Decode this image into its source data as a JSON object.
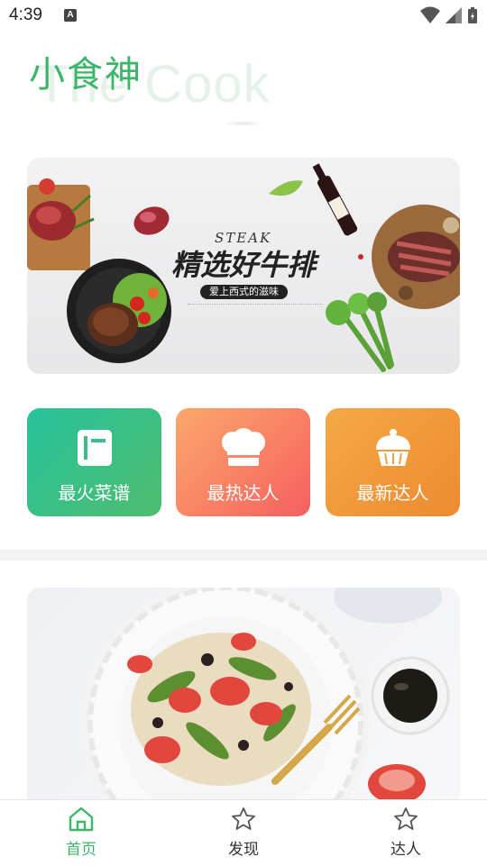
{
  "status_bar": {
    "time": "4:39",
    "notification_letter": "A"
  },
  "header": {
    "title": "小食神",
    "subtitle": "The Cook"
  },
  "banner": {
    "steak_word": "STEAK",
    "title": "精选好牛排",
    "subtitle": "爱上西式的滋味"
  },
  "categories": [
    {
      "label": "最火菜谱",
      "icon": "recipe-book-icon",
      "color": "#2fc08a"
    },
    {
      "label": "最热达人",
      "icon": "chef-hat-icon",
      "color": "#f77d62"
    },
    {
      "label": "最新达人",
      "icon": "cupcake-icon",
      "color": "#f09c3b"
    }
  ],
  "bottom_nav": [
    {
      "label": "首页",
      "icon": "home-icon",
      "active": true
    },
    {
      "label": "发现",
      "icon": "star-icon",
      "active": false
    },
    {
      "label": "达人",
      "icon": "star-icon",
      "active": false
    }
  ],
  "colors": {
    "accent": "#3fb56b",
    "nav_inactive": "#333333"
  }
}
